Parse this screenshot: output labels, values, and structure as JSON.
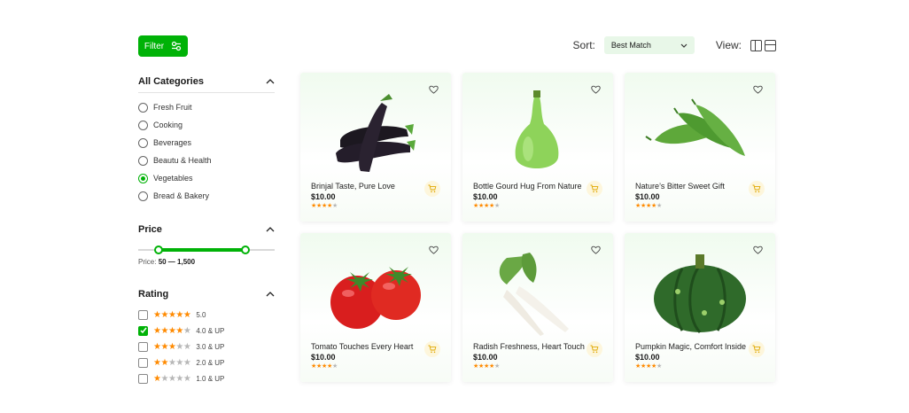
{
  "toolbar": {
    "filter_label": "Filter",
    "sort_label": "Sort:",
    "sort_value": "Best Match",
    "view_label": "View:"
  },
  "categories": {
    "title": "All Categories",
    "items": [
      {
        "label": "Fresh Fruit",
        "selected": false
      },
      {
        "label": "Cooking",
        "selected": false
      },
      {
        "label": "Beverages",
        "selected": false
      },
      {
        "label": "Beautu & Health",
        "selected": false
      },
      {
        "label": "Vegetables",
        "selected": true
      },
      {
        "label": "Bread & Bakery",
        "selected": false
      }
    ]
  },
  "price": {
    "title": "Price",
    "label": "Price:",
    "range": "50 — 1,500"
  },
  "rating": {
    "title": "Rating",
    "options": [
      {
        "label": "5.0",
        "stars": 5,
        "checked": false
      },
      {
        "label": "4.0 & UP",
        "stars": 4,
        "checked": true
      },
      {
        "label": "3.0 & UP",
        "stars": 3,
        "checked": false
      },
      {
        "label": "2.0 & UP",
        "stars": 2,
        "checked": false
      },
      {
        "label": "1.0 & UP",
        "stars": 1,
        "checked": false
      }
    ]
  },
  "products": [
    {
      "name": "Brinjal Taste, Pure Love",
      "price": "$10.00",
      "rating": 4,
      "icon": "eggplant-icon"
    },
    {
      "name": "Bottle Gourd Hug From Nature",
      "price": "$10.00",
      "rating": 4,
      "icon": "bottle-gourd-icon"
    },
    {
      "name": "Nature’s Bitter Sweet Gift",
      "price": "$10.00",
      "rating": 4,
      "icon": "bitter-gourd-icon"
    },
    {
      "name": "Tomato Touches Every Heart",
      "price": "$10.00",
      "rating": 4,
      "icon": "tomato-icon"
    },
    {
      "name": "Radish Freshness, Heart Touch",
      "price": "$10.00",
      "rating": 4,
      "icon": "radish-icon"
    },
    {
      "name": "Pumpkin Magic, Comfort Inside",
      "price": "$10.00",
      "rating": 4,
      "icon": "pumpkin-icon"
    }
  ],
  "colors": {
    "accent": "#00b207",
    "star": "#ff8a00",
    "sort_bg": "#e8f7e8"
  }
}
